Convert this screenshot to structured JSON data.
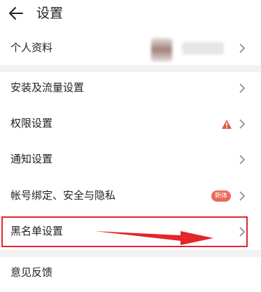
{
  "header": {
    "title": "设置"
  },
  "profile": {
    "label": "个人资料"
  },
  "menu": {
    "install": "安装及流量设置",
    "permissions": "权限设置",
    "notifications": "通知设置",
    "account": "帐号绑定、安全与隐私",
    "account_badge": "新体",
    "blacklist": "黑名单设置",
    "feedback": "意见反馈"
  },
  "colors": {
    "highlight": "#e2262a",
    "warning": "#e05a45",
    "badge": "#e86a5a"
  },
  "icons": {
    "back": "arrow-left-icon",
    "chevron": "chevron-right-icon",
    "warning": "warning-triangle-icon"
  }
}
